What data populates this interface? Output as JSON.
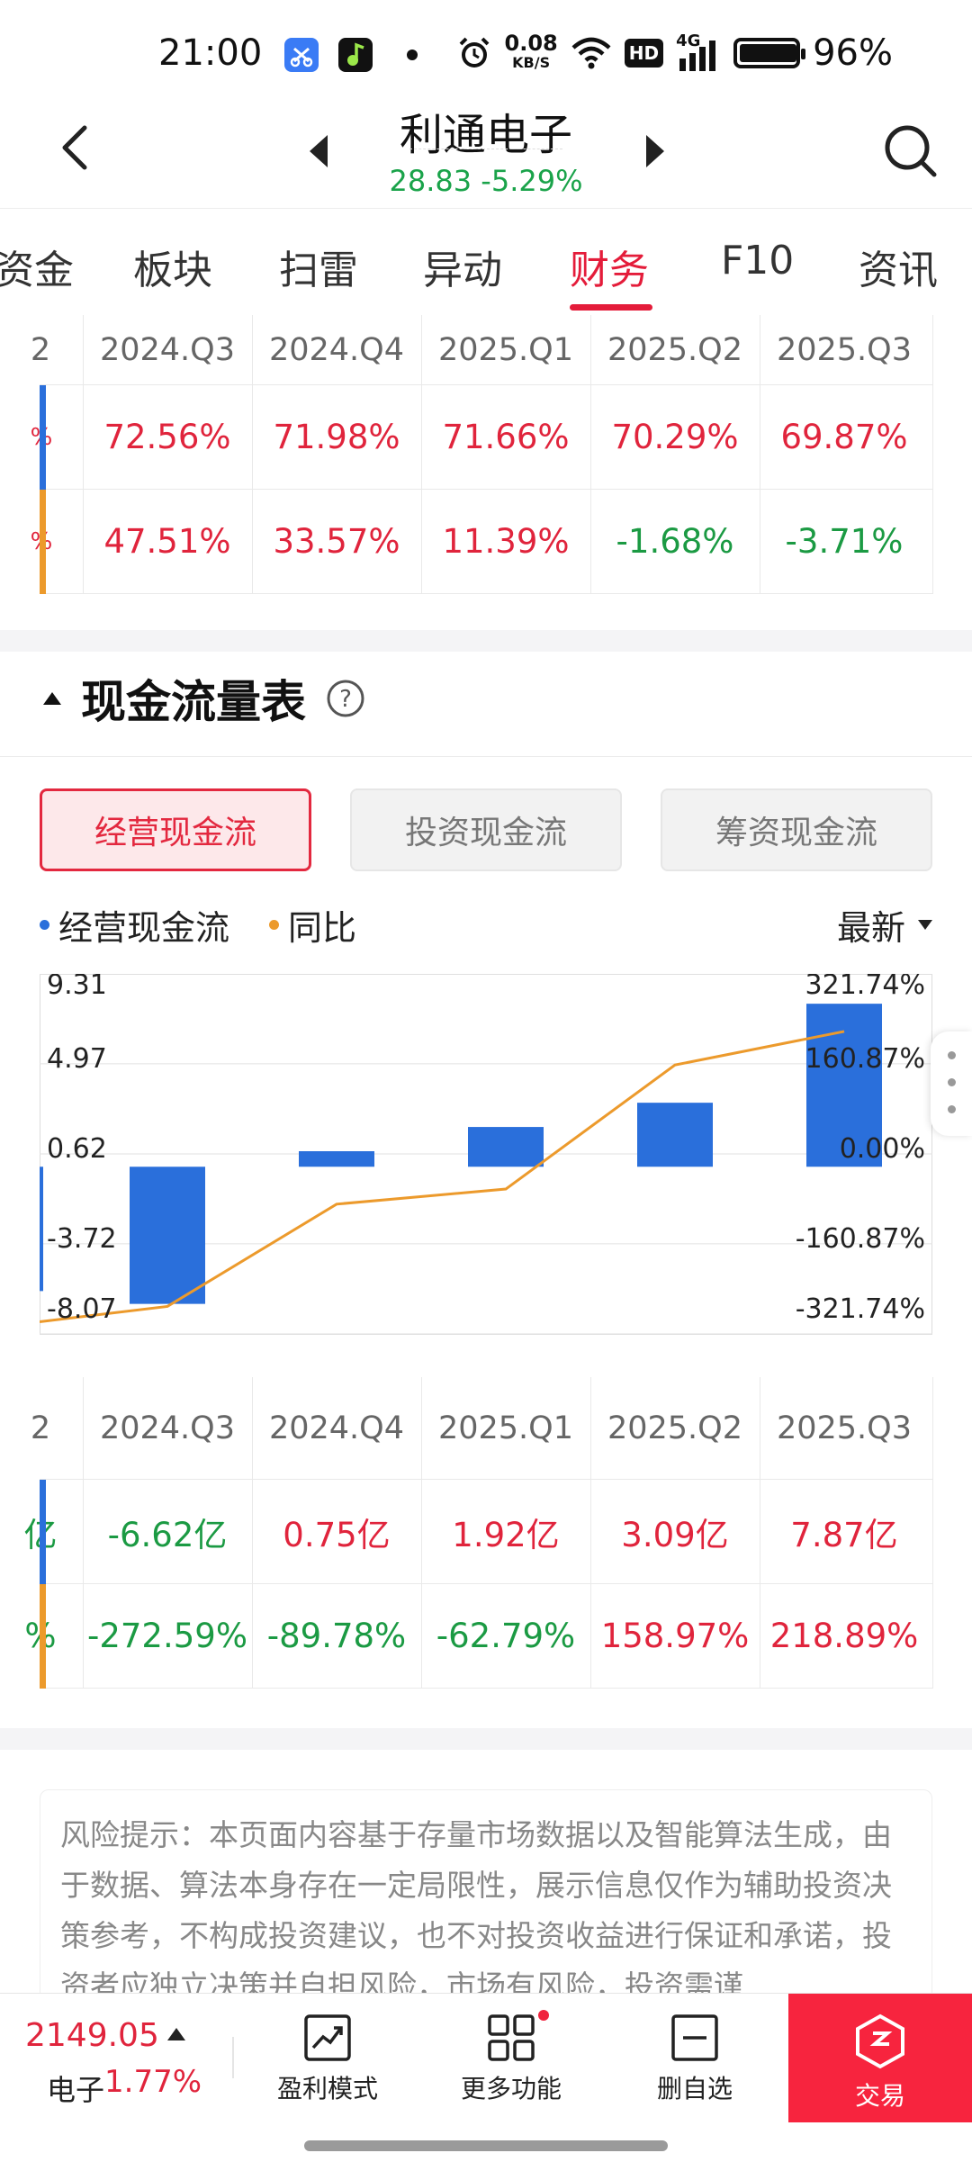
{
  "status_bar": {
    "time": "21:00",
    "net_speed_value": "0.08",
    "net_speed_unit": "KB/S",
    "hd_label": "HD",
    "net_label": "4G",
    "battery_percent": "96%",
    "battery_level": 0.96
  },
  "header": {
    "stock_name": "利通电子",
    "stock_price_change": "28.83 -5.29%"
  },
  "tabs": [
    {
      "label": "资金"
    },
    {
      "label": "板块"
    },
    {
      "label": "扫雷"
    },
    {
      "label": "异动"
    },
    {
      "label": "财务",
      "active": true
    },
    {
      "label": "F10"
    },
    {
      "label": "资讯"
    }
  ],
  "top_table": {
    "partial_header": "2",
    "headers": [
      "2024.Q3",
      "2024.Q4",
      "2025.Q1",
      "2025.Q2",
      "2025.Q3"
    ],
    "rows": [
      {
        "partial": "%",
        "values": [
          "72.56%",
          "71.98%",
          "71.66%",
          "70.29%",
          "69.87%"
        ],
        "signs": [
          "red",
          "red",
          "red",
          "red",
          "red"
        ]
      },
      {
        "partial": "%",
        "values": [
          "47.51%",
          "33.57%",
          "11.39%",
          "-1.68%",
          "-3.71%"
        ],
        "signs": [
          "red",
          "red",
          "red",
          "green",
          "green"
        ]
      }
    ]
  },
  "cashflow": {
    "section_title": "现金流量表",
    "help_symbol": "?",
    "buttons": [
      "经营现金流",
      "投资现金流",
      "筹资现金流"
    ],
    "legend": [
      "经营现金流",
      "同比"
    ],
    "period_selector": "最新"
  },
  "colors": {
    "bar_blue": "#2a6fdb",
    "line_orange": "#ec9a2c",
    "red": "#e0243c",
    "green": "#1b9a43"
  },
  "chart_data": {
    "type": "bar",
    "categories": [
      "2024.Q3",
      "2024.Q4",
      "2025.Q1",
      "2025.Q2",
      "2025.Q3"
    ],
    "series": [
      {
        "name": "经营现金流",
        "type": "bar",
        "axis": "left",
        "values": [
          -6.62,
          0.75,
          1.92,
          3.09,
          7.87
        ]
      },
      {
        "name": "同比",
        "type": "line",
        "axis": "right",
        "values": [
          -272.59,
          -89.78,
          -62.79,
          158.97,
          218.89
        ],
        "start_value": -300
      }
    ],
    "left_ticks": [
      "9.31",
      "4.97",
      "0.62",
      "-3.72",
      "-8.07"
    ],
    "right_ticks": [
      "321.74%",
      "160.87%",
      "0.00%",
      "-160.87%",
      "-321.74%"
    ],
    "left_ylim": [
      -8.07,
      9.31
    ],
    "right_ylim": [
      -321.74,
      321.74
    ],
    "grid": true
  },
  "bottom_table": {
    "partial_header": "2",
    "headers": [
      "2024.Q3",
      "2024.Q4",
      "2025.Q1",
      "2025.Q2",
      "2025.Q3"
    ],
    "rows": [
      {
        "partial": "亿",
        "values": [
          "-6.62亿",
          "0.75亿",
          "1.92亿",
          "3.09亿",
          "7.87亿"
        ],
        "signs": [
          "green",
          "red",
          "red",
          "red",
          "red"
        ]
      },
      {
        "partial": "%",
        "values": [
          "-272.59%",
          "-89.78%",
          "-62.79%",
          "158.97%",
          "218.89%"
        ],
        "signs": [
          "green",
          "green",
          "green",
          "red",
          "red"
        ]
      }
    ]
  },
  "disclaimer": "风险提示：本页面内容基于存量市场数据以及智能算法生成，由于数据、算法本身存在一定局限性，展示信息仅作为辅助投资决策参考，不构成投资建议，也不对投资收益进行保证和承诺，投资者应独立决策并自担风险，市场有风险，投资需谨",
  "bottom_bar": {
    "index_value": "2149.05",
    "index_label": "电子",
    "index_pct": "1.77%",
    "items": [
      "盈利模式",
      "更多功能",
      "删自选"
    ],
    "trade_label": "交易"
  }
}
